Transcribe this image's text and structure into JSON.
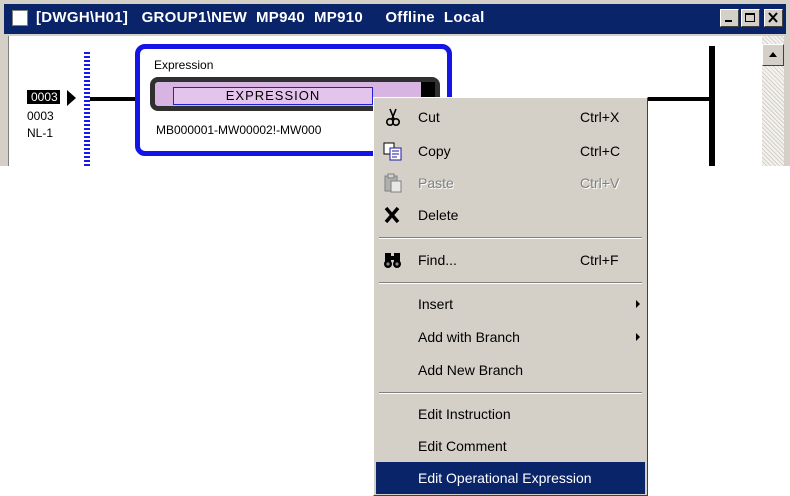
{
  "window": {
    "title": "[DWGH\\H01]   GROUP1\\NEW  MP940  MP910     Offline  Local",
    "buttons": [
      "minimize",
      "maximize",
      "close"
    ]
  },
  "ladder": {
    "step_number": "0003",
    "line_number": "0003",
    "nest_label": "NL-1",
    "expression": {
      "caption": "Expression",
      "name": "EXPRESSION",
      "formula": "MB000001-MW00002!-MW000"
    }
  },
  "context_menu": {
    "items": [
      {
        "label": "Cut",
        "shortcut": "Ctrl+X",
        "icon": "scissors-icon"
      },
      {
        "label": "Copy",
        "shortcut": "Ctrl+C",
        "icon": "copy-icon"
      },
      {
        "label": "Paste",
        "shortcut": "Ctrl+V",
        "icon": "paste-icon",
        "disabled": true
      },
      {
        "label": "Delete",
        "shortcut": "",
        "icon": "delete-x-icon"
      },
      {
        "label": "Find...",
        "shortcut": "Ctrl+F",
        "icon": "binoculars-icon"
      },
      {
        "label": "Insert",
        "submenu": true
      },
      {
        "label": "Add with Branch",
        "submenu": true
      },
      {
        "label": "Add New Branch"
      },
      {
        "label": "Edit Instruction"
      },
      {
        "label": "Edit Comment"
      },
      {
        "label": "Edit Operational Expression",
        "selected": true
      }
    ]
  },
  "colors": {
    "titlebar": "#0a246a",
    "menu_highlight": "#0a246a",
    "block_border": "#1414e6",
    "expression_fill": "#d8b4e2"
  }
}
